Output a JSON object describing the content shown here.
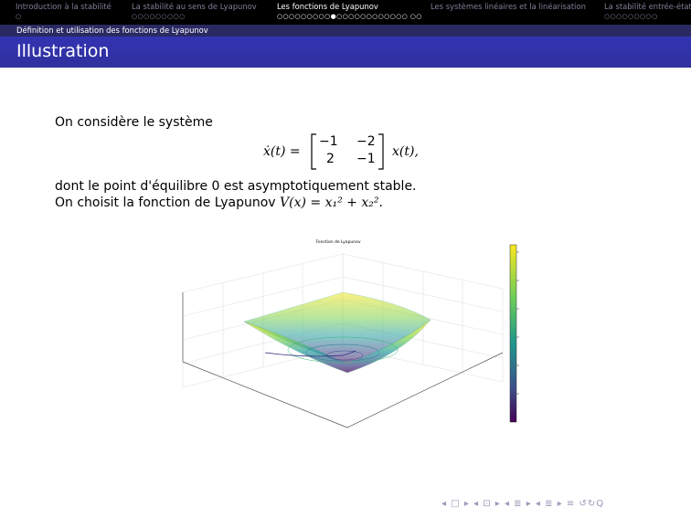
{
  "headline": {
    "sections": [
      {
        "label": "Introduction à la stabilité",
        "dots": "○",
        "active": false
      },
      {
        "label": "La stabilité au sens de Lyapunov",
        "dots": "○○○○○○○○○",
        "active": false
      },
      {
        "label": "Les fonctions de Lyapunov",
        "dots": "○○○○○○○○○●○○○○○○○○○○○○ ○○",
        "active": true
      },
      {
        "label": "Les systèmes linéaires et la linéarisation",
        "dots": "",
        "active": false
      },
      {
        "label": "La stabilité entrée-état",
        "dots": "○○○○○○○○○",
        "active": false
      }
    ]
  },
  "subsection": "Définition et utilisation des fonctions de Lyapunov",
  "frame_title": "Illustration",
  "body": {
    "line1": "On considère le système",
    "eq_lhs": "ẋ(t) =",
    "matrix": [
      "−1",
      "−2",
      "2",
      "−1"
    ],
    "eq_rhs": "x(t),",
    "line2": "dont le point d'équilibre 0 est asymptotiquement stable.",
    "line3_text": "On choisit la fonction de Lyapunov",
    "line3_formula": "V(x) = x₁² + x₂².",
    "figure_title": "Fonction de Lyapunov"
  },
  "nav": "◂ □ ▸ ◂ ⊡ ▸ ◂ ≣ ▸ ◂ ≣ ▸   ≡   ↺↻Q",
  "colors": {
    "frame_title_bg": "#3333b2",
    "subsection_bg": "#2a2a62",
    "headline_bg": "#000000"
  }
}
